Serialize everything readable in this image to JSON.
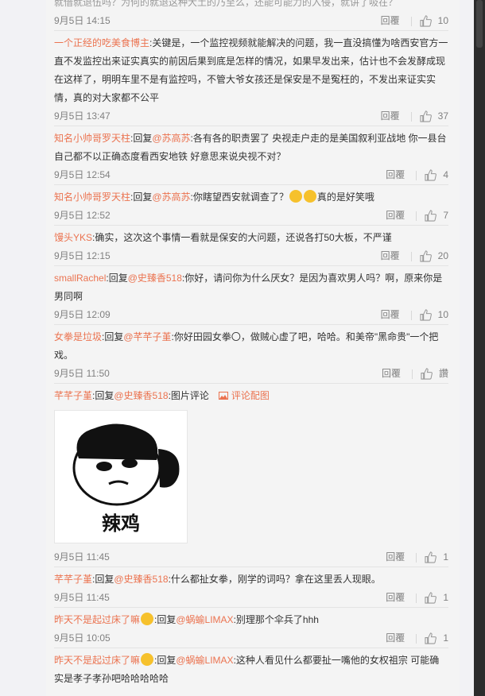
{
  "labels": {
    "reply": "回覆"
  },
  "comments": [
    {
      "user": "",
      "parts": [],
      "text": "就借就退伍吗？为何的就退这种大土的乃至么，还能可能力的入侵，就讲了吸在？",
      "time": "9月5日 14:15",
      "likes": "10"
    },
    {
      "user": "一个正经的吃美食博主",
      "text": ":关键是，一个监控视频就能解决的问题，我一直没搞懂为啥西安官方一直不发监控出来证实真实的前因后果到底是怎样的情况，如果早发出来，估计也不会发酵成现在这样了，明明车里不是有监控吗，不管大爷女孩还是保安是不是冤枉的，不发出来证实实情，真的对大家都不公平",
      "time": "9月5日 13:47",
      "likes": "37"
    },
    {
      "user": "知名小帅哥罗天柱",
      "pre": ":回复",
      "mention": "@苏高苏",
      "text": ":各有各的职责罢了 央视走户走的是美国叙利亚战地 你一县台自己都不以正确态度看西安地铁 好意思来说央视不对？",
      "time": "9月5日 12:54",
      "likes": "4"
    },
    {
      "user": "知名小帅哥罗天柱",
      "pre": ":回复",
      "mention": "@苏高苏",
      "text": ":你瞎望西安就调查了？",
      "after": "真的是好笑哦",
      "time": "9月5日 12:52",
      "likes": "7"
    },
    {
      "user": "馒头YKS",
      "text": ":确实，这次这个事情一看就是保安的大问题，还说各打50大板，不严谨",
      "time": "9月5日 12:15",
      "likes": "20"
    },
    {
      "user": "smallRachel",
      "pre": ":回复",
      "mention": "@史臻香518",
      "text": ":你好，请问你为什么厌女？是因为喜欢男人吗？啊，原来你是男同啊",
      "time": "9月5日 12:09",
      "likes": "10"
    },
    {
      "user": "女拳是垃圾",
      "pre": ":回复",
      "mention": "@芊芊子堇",
      "text": ":你好田园女拳〇，做贼心虚了吧，哈哈。和美帝\"黑命贵\"一个把戏。",
      "time": "9月5日 11:50",
      "likes": "讚"
    },
    {
      "user": "芊芊子堇",
      "pre": ":回复",
      "mention": "@史臻香518",
      "text": ":图片评论",
      "pic_link": "评论配图",
      "image_caption": "辣鸡",
      "time": "9月5日 11:45",
      "likes": "1"
    },
    {
      "user": "芊芊子堇",
      "pre": ":回复",
      "mention": "@史臻香518",
      "text": ":什么都扯女拳，刚学的词吗？拿在这里丢人现眼。",
      "time": "9月5日 11:45",
      "likes": "1"
    },
    {
      "user": "昨天不是起过床了嘛",
      "pre": ":回复",
      "mention": "@蜗蝓LIMAX",
      "text": ":别理那个伞兵了hhh",
      "time": "9月5日 10:05",
      "likes": "1"
    },
    {
      "user": "昨天不是起过床了嘛",
      "pre": ":回复",
      "mention": "@蜗蝓LIMAX",
      "text": ":这种人看见什么都要扯一嘴他的女权祖宗 可能确实是孝子孝孙吧哈哈哈哈哈",
      "time": "",
      "likes": ""
    }
  ]
}
